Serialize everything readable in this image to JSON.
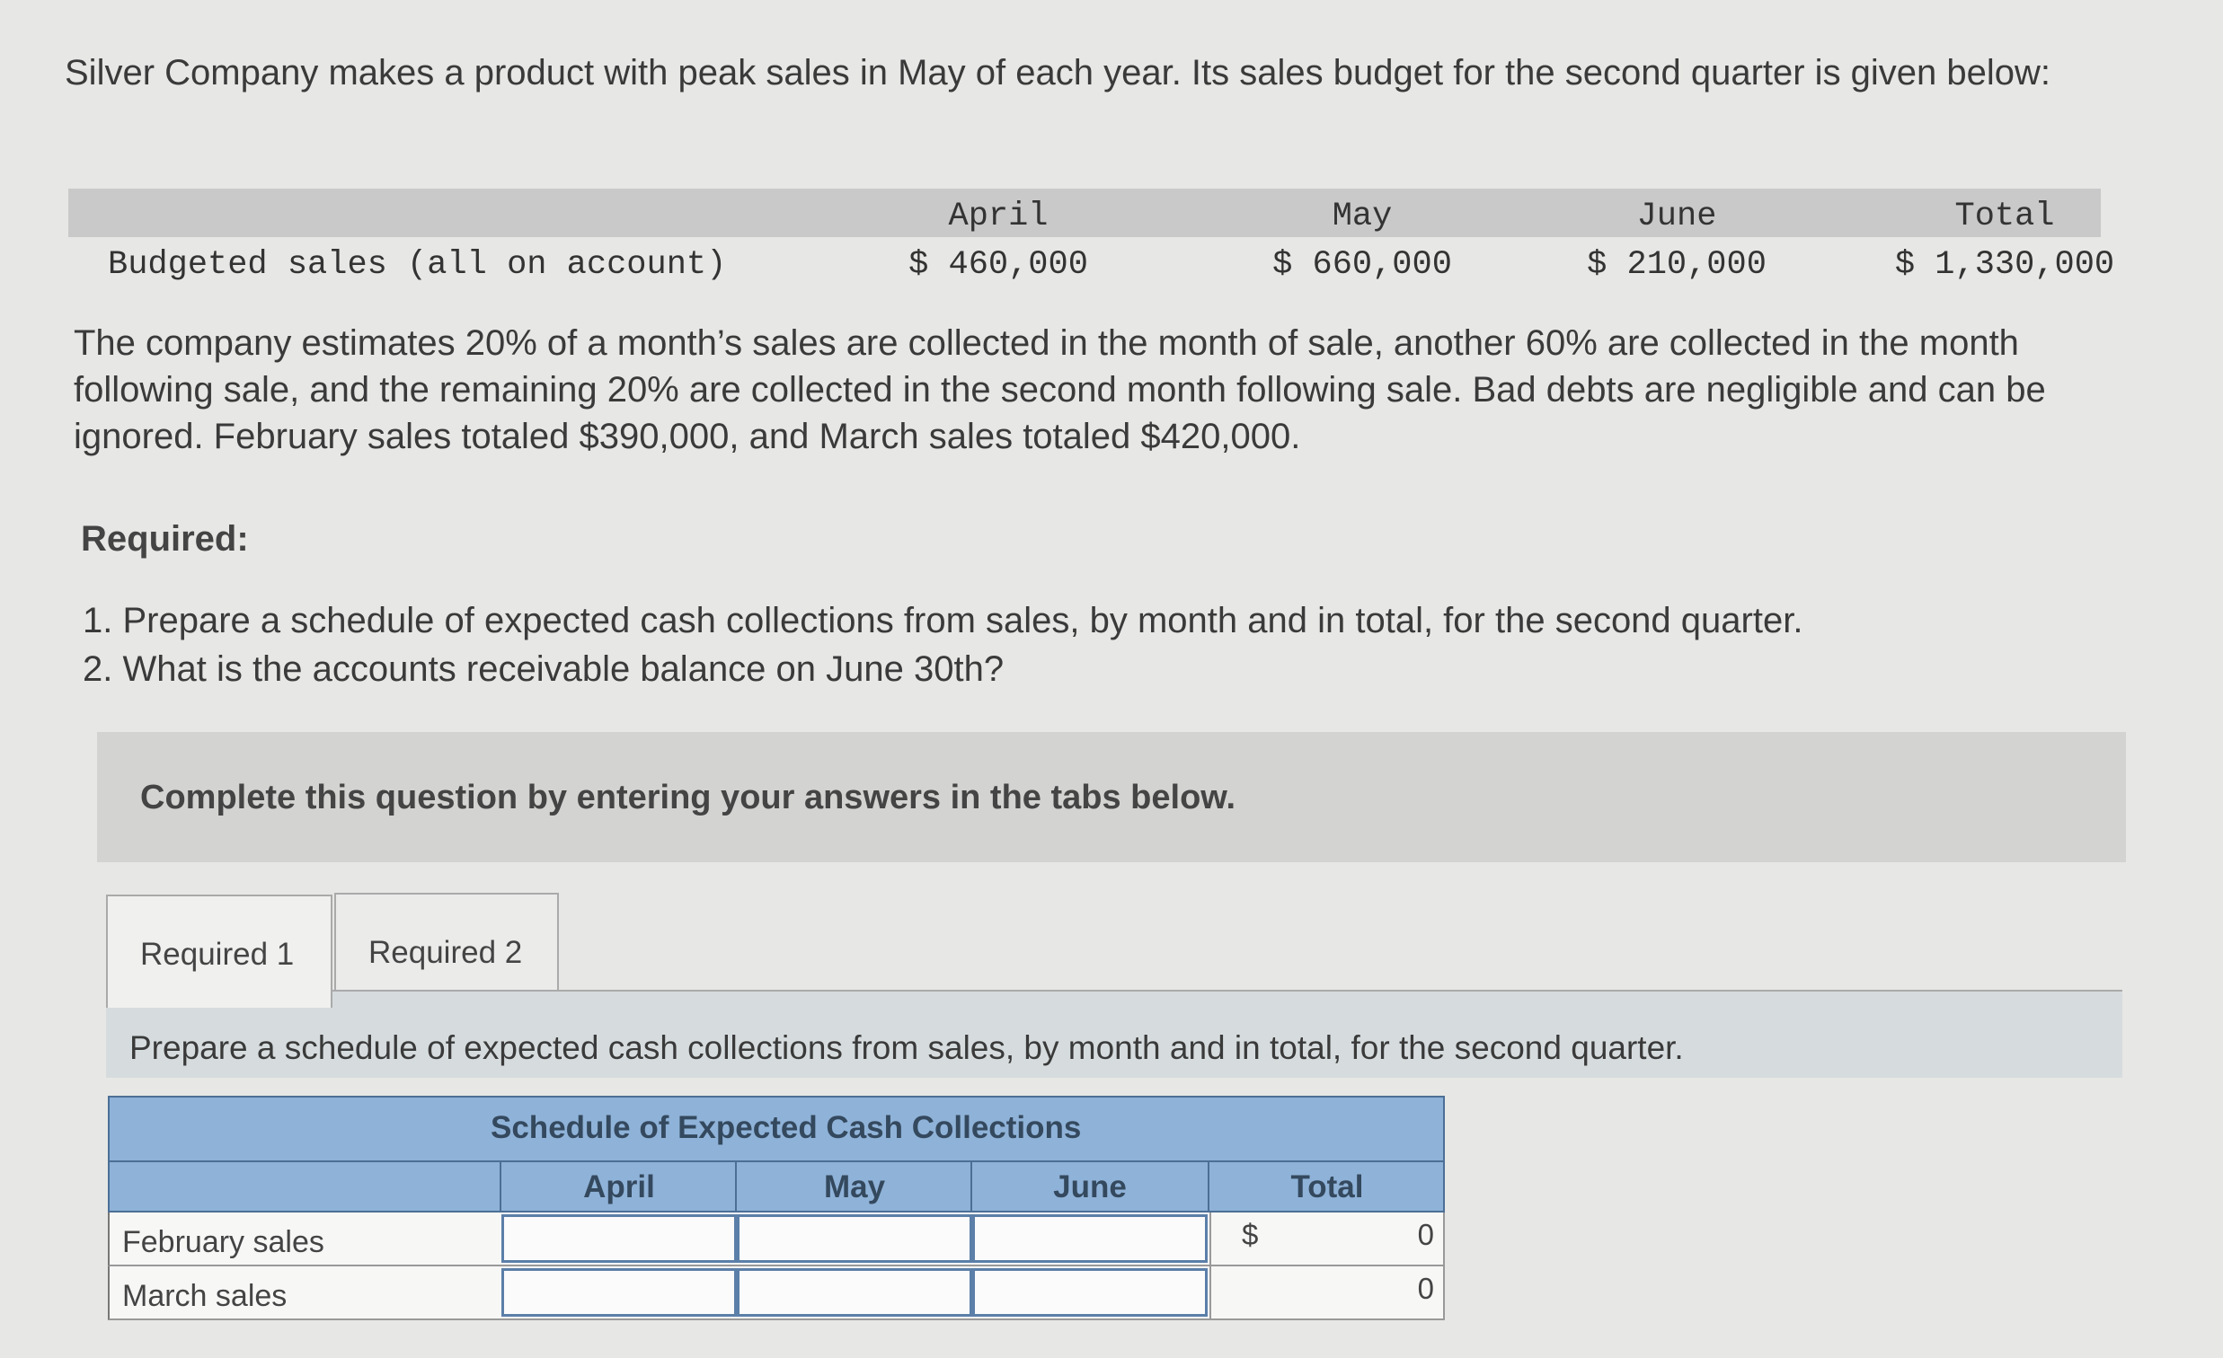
{
  "intro": "Silver Company makes a product with peak sales in May of each year. Its sales budget for the second quarter is given below:",
  "sales_budget": {
    "headers": [
      "April",
      "May",
      "June",
      "Total"
    ],
    "row_label": "Budgeted sales (all on account)",
    "values": [
      "$ 460,000",
      "$ 660,000",
      "$ 210,000",
      "$ 1,330,000"
    ]
  },
  "paragraph": "The company estimates 20% of a month’s sales are collected in the month of sale, another 60% are collected in the month following sale, and the remaining 20% are collected in the second month following sale. Bad debts are negligible and can be ignored. February sales totaled $390,000, and March sales totaled $420,000.",
  "required": {
    "heading": "Required:",
    "items": [
      "1. Prepare a schedule of expected cash collections from sales, by month and in total, for the second quarter.",
      "2. What is the accounts receivable balance on June 30th?"
    ]
  },
  "banner": "Complete this question by entering your answers in the tabs below.",
  "tabs": [
    "Required 1",
    "Required 2"
  ],
  "instruction": "Prepare a schedule of expected cash collections from sales, by month and in total, for the second quarter.",
  "schedule": {
    "title": "Schedule of Expected Cash Collections",
    "columns": [
      "April",
      "May",
      "June",
      "Total"
    ],
    "rows": [
      {
        "label": "February sales",
        "currency": "$",
        "total": "0"
      },
      {
        "label": "March sales",
        "currency": "",
        "total": "0"
      }
    ]
  }
}
